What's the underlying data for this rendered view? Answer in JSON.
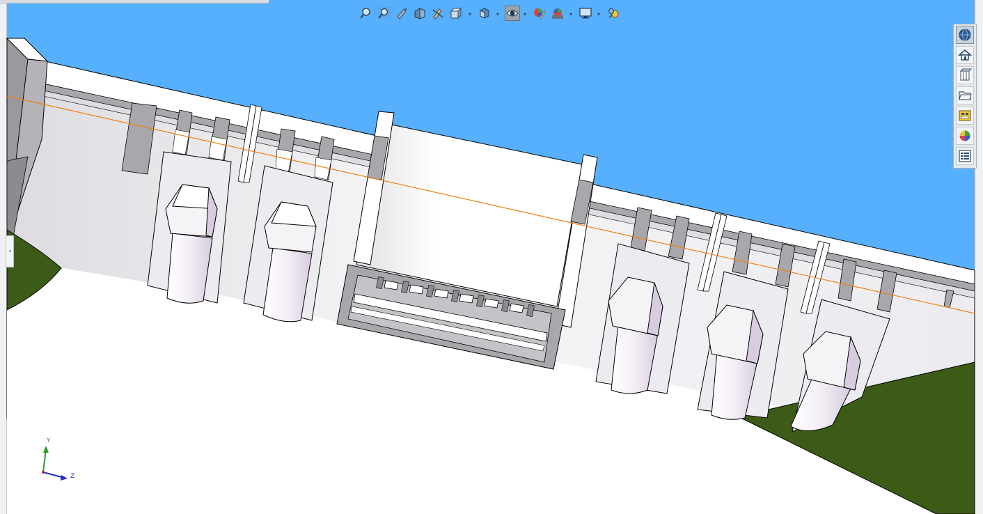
{
  "toolbar": {
    "buttons": [
      {
        "id": "zoom-to-fit",
        "icon": "zoom-to-fit-icon",
        "active": false
      },
      {
        "id": "zoom-to-area",
        "icon": "zoom-to-area-icon",
        "active": false
      },
      {
        "id": "previous-view",
        "icon": "previous-view-icon",
        "active": false
      },
      {
        "id": "section-view",
        "icon": "section-view-icon",
        "active": false
      },
      {
        "id": "dynamic-annotation",
        "icon": "dynamic-annotation-icon",
        "active": false
      },
      {
        "id": "view-orientation",
        "icon": "view-orientation-icon",
        "active": false
      },
      {
        "id": "display-style",
        "icon": "display-style-icon",
        "active": false
      },
      {
        "id": "hide-show-items",
        "icon": "eye-icon",
        "active": true
      },
      {
        "id": "edit-appearance",
        "icon": "edit-appearance-icon",
        "active": false
      },
      {
        "id": "apply-scene",
        "icon": "apply-scene-icon",
        "active": false
      },
      {
        "id": "view-settings",
        "icon": "monitor-icon",
        "active": false
      },
      {
        "id": "realview",
        "icon": "realview-icon",
        "active": false
      }
    ]
  },
  "taskpane": {
    "items": [
      {
        "id": "solidworks-resources",
        "icon": "globe-resources-icon"
      },
      {
        "id": "home",
        "icon": "home-icon"
      },
      {
        "id": "design-library",
        "icon": "design-library-icon"
      },
      {
        "id": "file-explorer",
        "icon": "folder-icon"
      },
      {
        "id": "view-palette",
        "icon": "view-palette-icon"
      },
      {
        "id": "appearances",
        "icon": "appearances-icon"
      },
      {
        "id": "custom-properties",
        "icon": "custom-properties-icon"
      }
    ]
  },
  "triad": {
    "y_label": "Y",
    "z_label": "Z"
  },
  "colors": {
    "sky": "#56b0fd",
    "ground": "#3c5b16",
    "highlight_line": "#f08010",
    "concrete": "#f4f4f6",
    "shadow": "#a8a8ac",
    "pipe": "#e8e0ee"
  }
}
